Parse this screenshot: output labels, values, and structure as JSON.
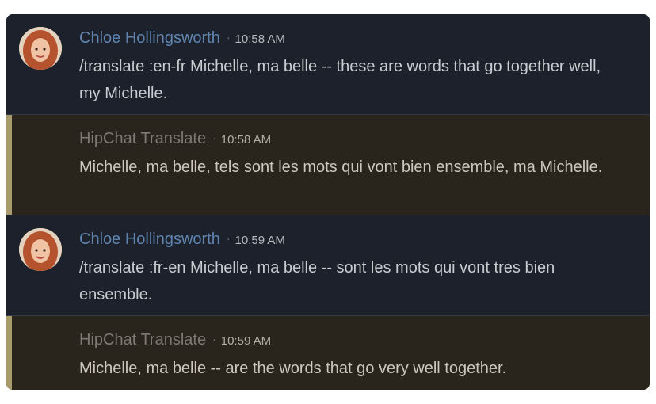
{
  "colors": {
    "panel_bg": "#1c212b",
    "bot_bg": "#2a251c",
    "bot_accent": "#a89a6a",
    "user_name": "#5f84b0",
    "bot_name": "#7c7a74",
    "text": "#c9ccd1"
  },
  "messages": [
    {
      "type": "user",
      "sender": "Chloe Hollingsworth",
      "separator": "·",
      "time": "10:58 AM",
      "text": "/translate :en-fr Michelle, ma belle -- these are words that go together well, my Michelle."
    },
    {
      "type": "bot",
      "sender": "HipChat Translate",
      "separator": "·",
      "time": "10:58 AM",
      "text": "Michelle, ma belle, tels sont les mots qui vont bien ensemble, ma Michelle."
    },
    {
      "type": "user",
      "sender": "Chloe Hollingsworth",
      "separator": "·",
      "time": "10:59 AM",
      "text": "/translate :fr-en Michelle, ma belle -- sont les mots qui vont tres bien ensemble."
    },
    {
      "type": "bot",
      "sender": "HipChat Translate",
      "separator": "·",
      "time": "10:59 AM",
      "text": "Michelle, ma belle -- are the words that go very well together."
    }
  ]
}
